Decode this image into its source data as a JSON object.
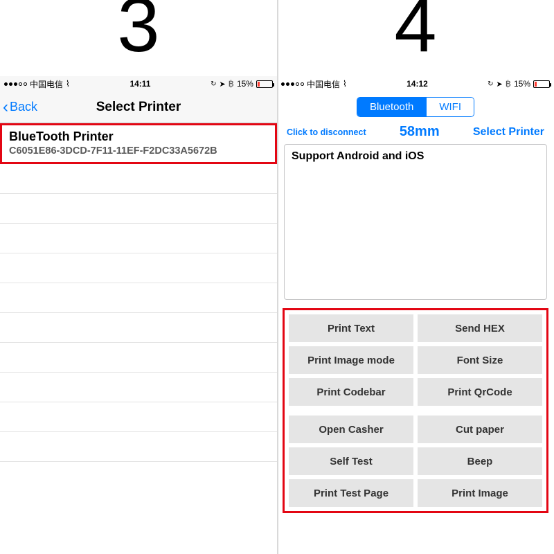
{
  "labels": {
    "screen3_num": "3",
    "screen4_num": "4"
  },
  "statusbar": {
    "carrier": "中国电信",
    "time3": "14:11",
    "time4": "14:12",
    "battery_pct": "15%"
  },
  "screen3": {
    "back_label": "Back",
    "title": "Select Printer",
    "printer": {
      "name": "BlueTooth Printer",
      "uuid": "C6051E86-3DCD-7F11-11EF-F2DC33A5672B"
    }
  },
  "screen4": {
    "tabs": {
      "bt": "Bluetooth",
      "wifi": "WIFI"
    },
    "disconnect": "Click to disconnect",
    "paper_size": "58mm",
    "select_printer": "Select Printer",
    "textarea_text": "Support Android and iOS",
    "buttons_group1": [
      "Print Text",
      "Send HEX",
      "Print Image mode",
      "Font Size",
      "Print Codebar",
      "Print QrCode"
    ],
    "buttons_group2": [
      "Open Casher",
      "Cut paper",
      "Self Test",
      "Beep",
      "Print Test Page",
      "Print Image"
    ]
  }
}
